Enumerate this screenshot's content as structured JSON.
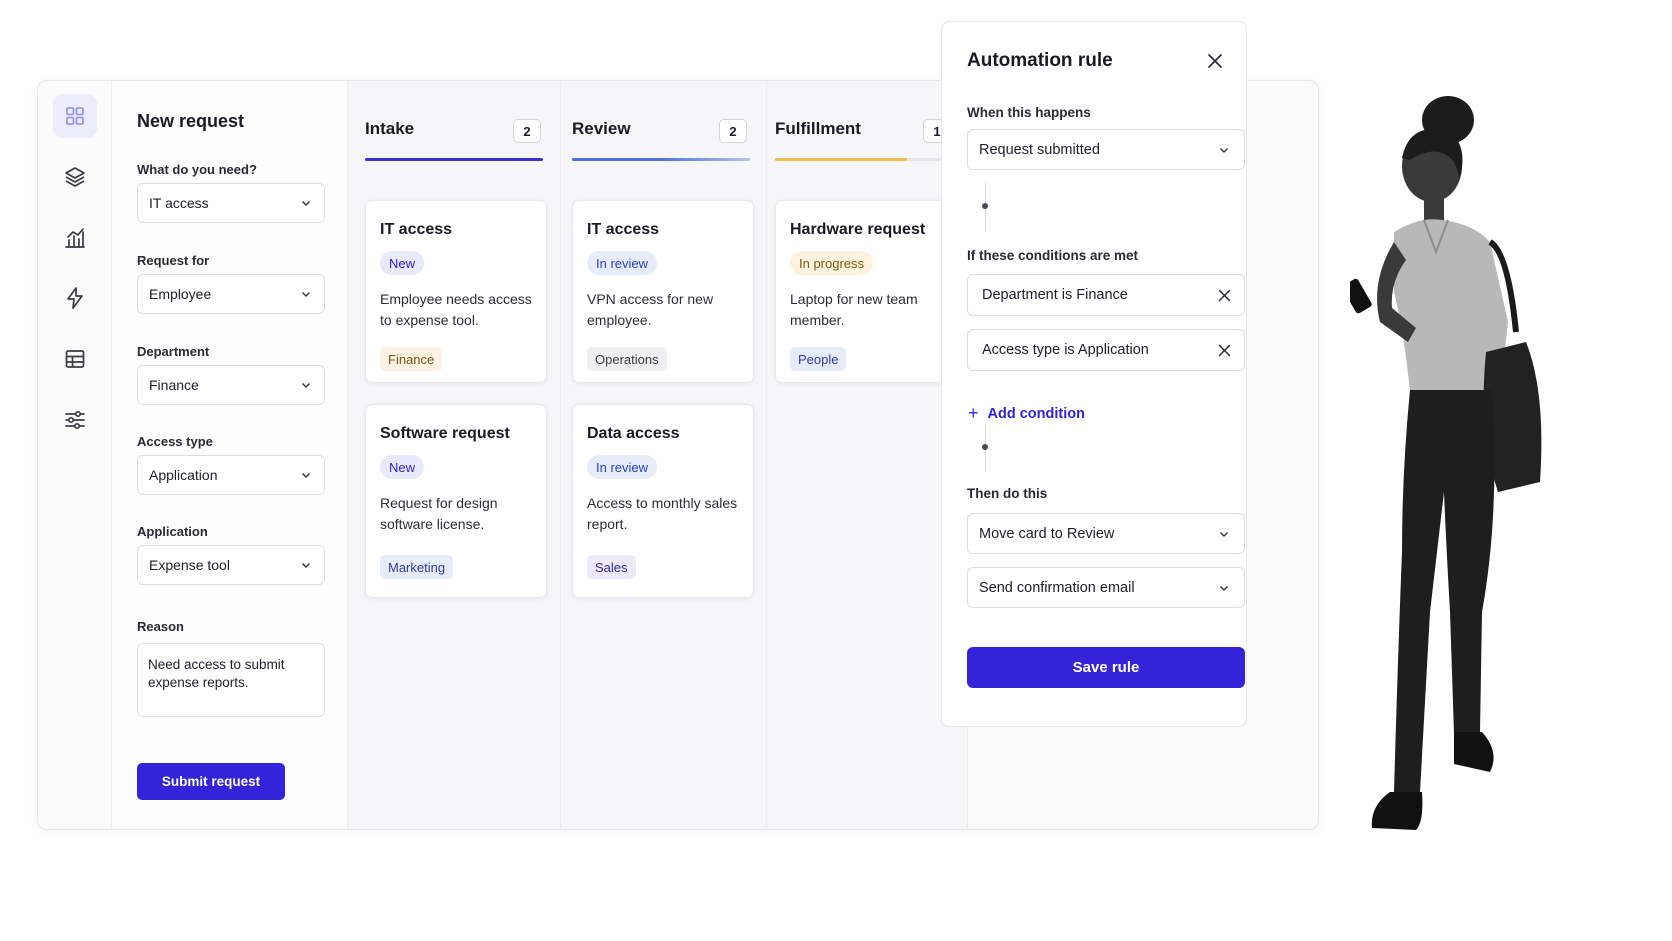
{
  "nav": {
    "items": [
      {
        "icon": "grid-icon",
        "active": true
      },
      {
        "icon": "layers-icon",
        "active": false
      },
      {
        "icon": "chart-icon",
        "active": false
      },
      {
        "icon": "lightning-icon",
        "active": false
      },
      {
        "icon": "table-icon",
        "active": false
      },
      {
        "icon": "sliders-icon",
        "active": false
      }
    ]
  },
  "form": {
    "title": "New request",
    "need_label": "What do you need?",
    "need_value": "IT access",
    "request_for_label": "Request for",
    "request_for_value": "Employee",
    "department_label": "Department",
    "department_value": "Finance",
    "access_type_label": "Access type",
    "access_type_value": "Application",
    "application_label": "Application",
    "application_value": "Expense tool",
    "reason_label": "Reason",
    "reason_value": "Need access to submit expense reports.",
    "submit_label": "Submit request"
  },
  "board": {
    "columns": [
      {
        "title": "Intake",
        "count": "2",
        "accent": "#3a2fd6",
        "cards": [
          {
            "title": "IT access",
            "status": "New",
            "description": "Employee needs access to expense tool.",
            "tag": "Finance"
          },
          {
            "title": "Software request",
            "status": "New",
            "description": "Request for design software license.",
            "tag": "Marketing"
          }
        ]
      },
      {
        "title": "Review",
        "count": "2",
        "accent": "#4d74e0",
        "cards": [
          {
            "title": "IT access",
            "status": "In review",
            "description": "VPN access for new employee.",
            "tag": "Operations"
          },
          {
            "title": "Data access",
            "status": "In review",
            "description": "Access to monthly sales report.",
            "tag": "Sales"
          }
        ]
      },
      {
        "title": "Fulfillment",
        "count": "1",
        "accent": "#f2bd4b",
        "cards": [
          {
            "title": "Hardware request",
            "status": "In progress",
            "description": "Laptop for new team member.",
            "tag": "People"
          }
        ]
      }
    ]
  },
  "automation": {
    "title": "Automation rule",
    "trigger_label": "When this happens",
    "trigger_value": "Request submitted",
    "conditions_label": "If these conditions are met",
    "conditions": [
      "Department is Finance",
      "Access type is Application"
    ],
    "add_condition_label": "Add condition",
    "actions_label": "Then do this",
    "actions": [
      "Move card to Review",
      "Send confirmation email"
    ],
    "save_label": "Save rule"
  },
  "colors": {
    "primary": "#3323d9",
    "review_accent": "#4d74e0",
    "fulfillment_accent": "#f2bd4b"
  }
}
